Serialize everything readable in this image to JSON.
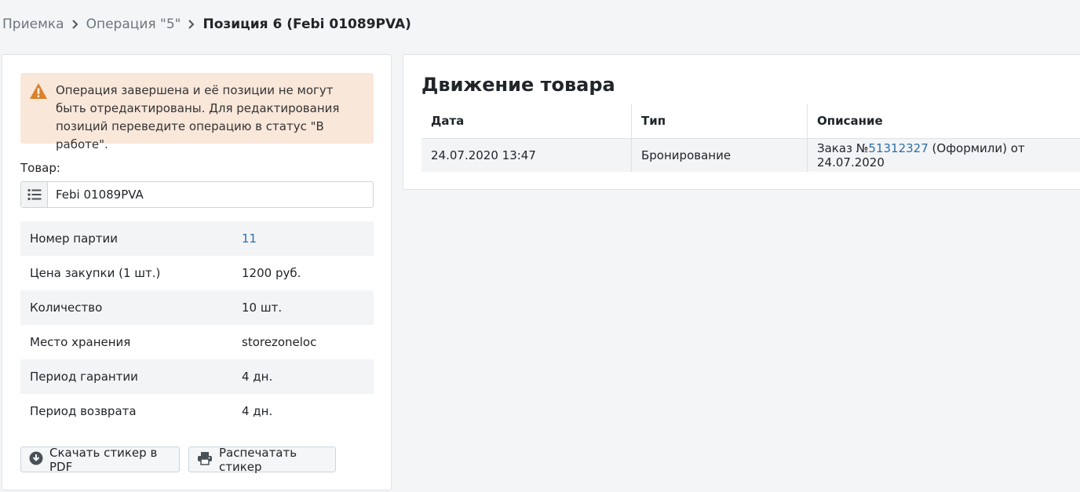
{
  "breadcrumb": {
    "items": [
      "Приемка",
      "Операция \"5\""
    ],
    "current": "Позиция 6 (Febi 01089PVA)"
  },
  "alert": {
    "text": "Операция завершена и её позиции не могут быть отредактированы. Для редактирования позиций переведите операцию в статус \"В работе\"."
  },
  "product": {
    "label": "Товар:",
    "value": "Febi 01089PVA"
  },
  "properties": [
    {
      "name": "Номер партии",
      "value": "11",
      "link": true
    },
    {
      "name": "Цена закупки (1 шт.)",
      "value": "1200 руб.",
      "link": false
    },
    {
      "name": "Количество",
      "value": "10 шт.",
      "link": false
    },
    {
      "name": "Место хранения",
      "value": "storezoneloc",
      "link": false
    },
    {
      "name": "Период гарантии",
      "value": "4 дн.",
      "link": false
    },
    {
      "name": "Период возврата",
      "value": "4 дн.",
      "link": false
    }
  ],
  "buttons": {
    "pdf": "Скачать стикер в PDF",
    "print": "Распечатать стикер"
  },
  "movement": {
    "title": "Движение товара",
    "columns": [
      "Дата",
      "Тип",
      "Описание"
    ],
    "rows": [
      {
        "date": "24.07.2020 13:47",
        "type": "Бронирование",
        "desc_prefix": "Заказ №",
        "order": "51312327",
        "desc_suffix": " (Оформили) от 24.07.2020"
      }
    ]
  },
  "colors": {
    "link": "#2c6ea8",
    "alert_bg": "#f9e7da",
    "warning_icon": "#d9822b"
  }
}
